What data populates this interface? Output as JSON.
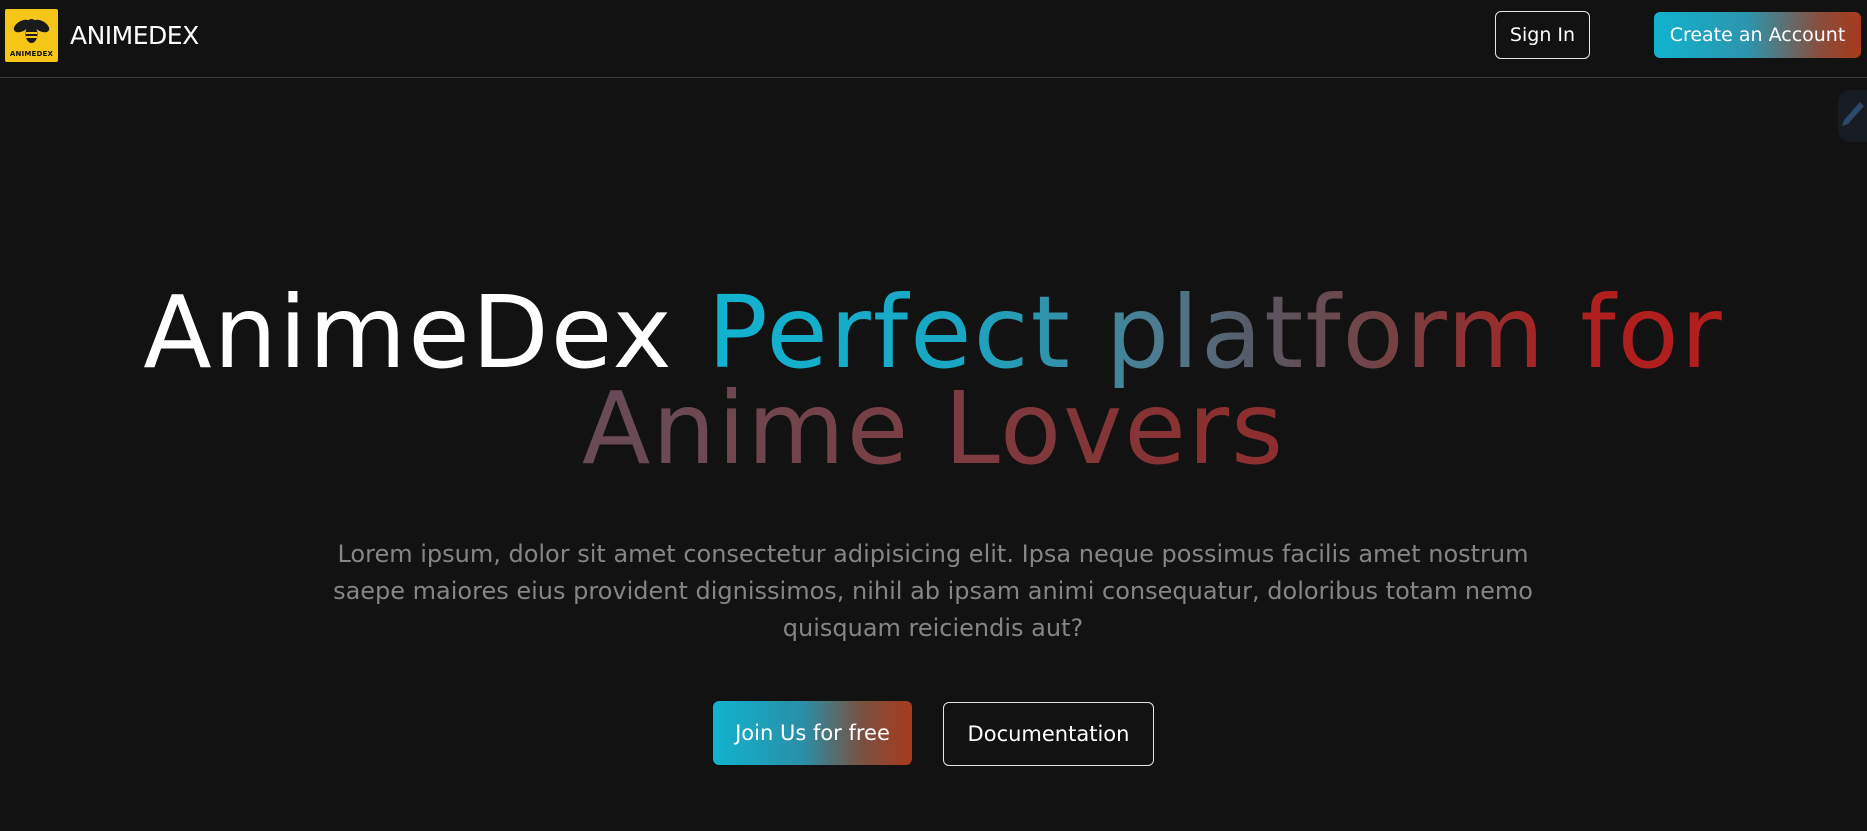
{
  "header": {
    "logo_badge_text": "ANIMEDEX",
    "brand_name": "ANIMEDEX",
    "sign_in_label": "Sign In",
    "create_account_label": "Create an Account"
  },
  "hero": {
    "title_plain": "AnimeDex",
    "title_gradient_1": "Perfect platform for",
    "title_gradient_2": "Anime Lovers",
    "description": "Lorem ipsum, dolor sit amet consectetur adipisicing elit. Ipsa neque possimus facilis amet nostrum saepe maiores eius provident dignissimos, nihil ab ipsam animi consequatur, doloribus totam nemo quisquam reiciendis aut?",
    "join_label": "Join Us for free",
    "docs_label": "Documentation"
  },
  "icons": {
    "logo": "bee-logo-icon",
    "corner": "pencil-icon"
  },
  "colors": {
    "background": "#121212",
    "accent_cyan": "#12b3d0",
    "accent_red": "#b01e1e",
    "logo_yellow": "#f5c518",
    "muted_text": "#858585"
  }
}
